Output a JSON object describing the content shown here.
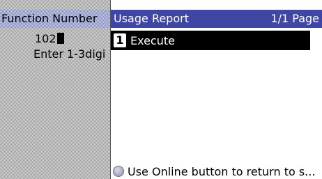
{
  "left_panel": {
    "header": "Function Number",
    "input_value": "102",
    "hint": "Enter 1-3digi"
  },
  "right_panel": {
    "title": "Usage Report",
    "page_indicator": "1/1 Page",
    "items": [
      {
        "number": "1",
        "label": "Execute",
        "selected": true
      }
    ],
    "footer_text": "Use Online button to return to s..."
  },
  "colors": {
    "header_blue": "#3f46a4",
    "selected_bg": "#000000"
  },
  "icons": {
    "footer": "online-button-icon"
  }
}
